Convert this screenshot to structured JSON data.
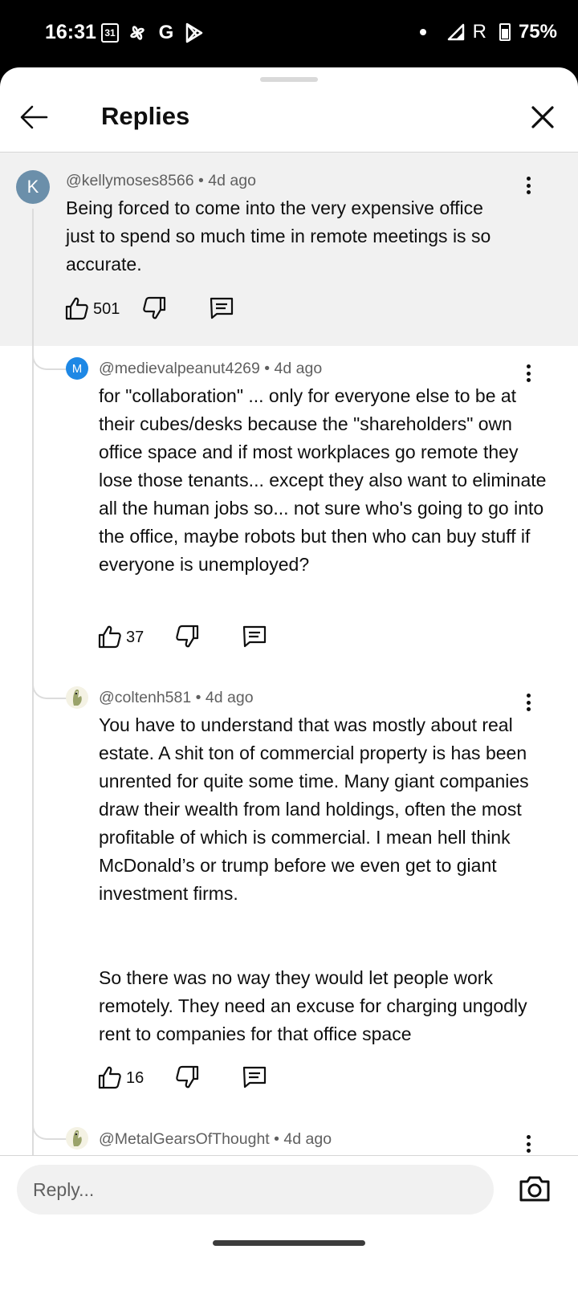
{
  "status_bar": {
    "time": "16:31",
    "calendar_day": "31",
    "google_letter": "G",
    "network_label": "R",
    "battery": "75%"
  },
  "header": {
    "title": "Replies",
    "back_icon": "arrow-left-icon",
    "close_icon": "close-icon"
  },
  "comments": [
    {
      "avatar_letter": "K",
      "author": "@kellymoses8566",
      "time": "4d ago",
      "text": "Being forced to come into the very expensive office just to spend so much time in remote meetings is so accurate.",
      "likes": "501"
    },
    {
      "avatar_letter": "M",
      "author": "@medievalpeanut4269",
      "time": "4d ago",
      "text": "for \"collaboration\" ... only for everyone else to be at their cubes/desks because the \"shareholders\" own office space  and if most workplaces go remote they lose those tenants... except they also want to eliminate all the human jobs so... not sure who's going to go into the office, maybe robots but then who can buy stuff if everyone is unemployed?",
      "likes": "37"
    },
    {
      "avatar_letter": "",
      "author": "@coltenh581",
      "time": "4d ago",
      "text": "You have to understand that was mostly about real estate. A shit ton of commercial property is has been unrented for quite some time. Many giant companies draw their wealth from land holdings, often the most profitable of which is commercial. I mean hell think McDonald’s or trump before we even get to giant investment firms.",
      "text2": "So there was no way they would let people work remotely. They need an excuse for charging ungodly rent to companies for that office space",
      "likes": "16"
    },
    {
      "avatar_letter": "",
      "author": "@MetalGearsOfThought",
      "time": "4d ago"
    }
  ],
  "reply_bar": {
    "placeholder": "Reply..."
  },
  "colors": {
    "highlight_bg": "#f1f1f1",
    "secondary_text": "#606060",
    "avatar_k": "#6b8faa",
    "avatar_m": "#1e88e5"
  }
}
